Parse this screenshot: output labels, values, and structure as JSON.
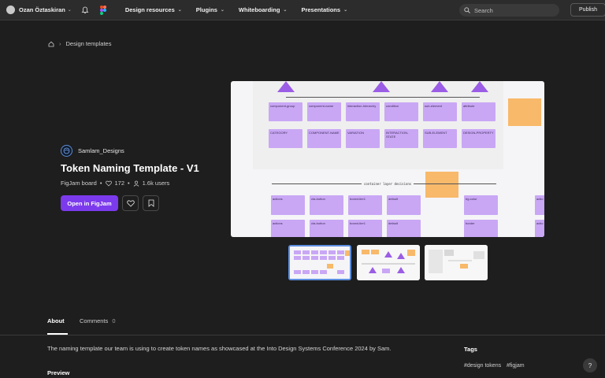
{
  "topnav": {
    "username": "Ozan Öztaskiran",
    "menu": [
      {
        "label": "Design resources"
      },
      {
        "label": "Plugins"
      },
      {
        "label": "Whiteboarding"
      },
      {
        "label": "Presentations"
      }
    ],
    "search_placeholder": "Search",
    "publish_label": "Publish"
  },
  "breadcrumb": {
    "item": "Design templates"
  },
  "file": {
    "creator": "Samlam_Designs",
    "title": "Token Naming Template - V1",
    "type": "FigJam board",
    "likes": "172",
    "users": "1.6k users",
    "open_label": "Open in FigJam"
  },
  "board": {
    "row1": [
      "component-group",
      "component-name",
      "interaction-hierarchy",
      "condition",
      "sub-element",
      "attribute"
    ],
    "row2": [
      "CATEGORY",
      "COMPONENT-NAME",
      "VARIATION",
      "INTERACTION-STATE",
      "SUB-ELEMENT",
      "DESIGN-PROPERTY"
    ],
    "separator": "container layer decisions",
    "row3": [
      "actions",
      "cta-button",
      "boxed-tier1",
      "default",
      "bg-color",
      "actio"
    ],
    "row4": [
      "actions",
      "cta-button",
      "boxed-tier1",
      "default",
      "border",
      "actio"
    ]
  },
  "tabs": {
    "about": "About",
    "comments": "Comments",
    "comments_count": "0"
  },
  "description": "The naming template our team is using to create token names as showcased at the Into Design Systems Conference 2024 by Sam.",
  "preview_heading": "Preview",
  "tags_heading": "Tags",
  "tags": [
    "#design tokens",
    "#figjam"
  ],
  "help": "?",
  "colors": {
    "accent": "#7c3aed",
    "card": "#c9a7f5",
    "triangle": "#9b5de5",
    "sticky": "#f8b96a"
  }
}
